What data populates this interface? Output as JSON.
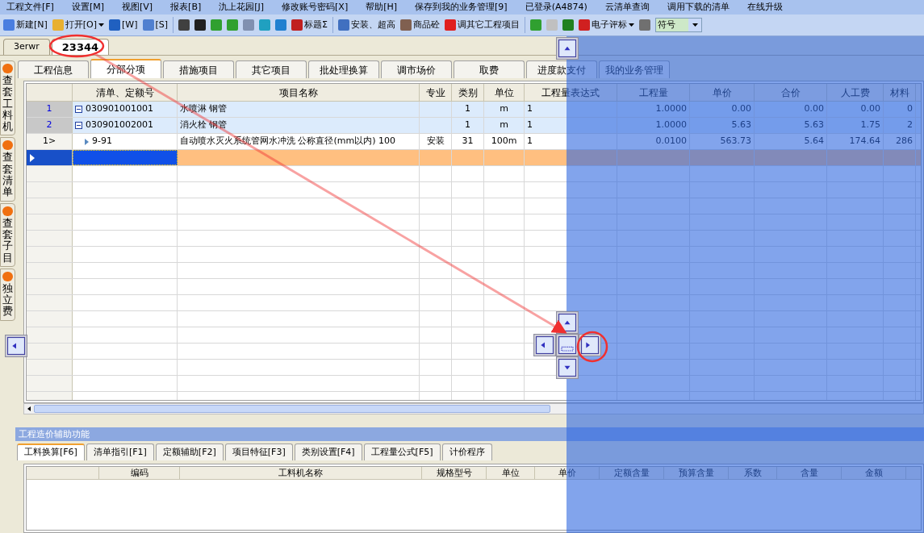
{
  "menu": [
    "工程文件[F]",
    "设置[M]",
    "视图[V]",
    "报表[B]",
    "氿上花园[J]",
    "修改账号密码[X]",
    "帮助[H]",
    "保存到我的业务管理[9]",
    "已登录(A4874)",
    "云清单查询",
    "调用下载的清单",
    "在线升级"
  ],
  "toolbar": [
    {
      "kind": "button",
      "label": "新建[N]"
    },
    {
      "kind": "dropdown",
      "label": "打开[O]"
    },
    {
      "kind": "button",
      "label": "[W]"
    },
    {
      "kind": "button",
      "label": "[S]"
    },
    {
      "kind": "separator"
    },
    {
      "kind": "icon"
    },
    {
      "kind": "icon"
    },
    {
      "kind": "icon"
    },
    {
      "kind": "icon"
    },
    {
      "kind": "icon"
    },
    {
      "kind": "icon"
    },
    {
      "kind": "icon"
    },
    {
      "kind": "button",
      "label": "标题Σ"
    },
    {
      "kind": "separator"
    },
    {
      "kind": "button",
      "label": "安装、超高"
    },
    {
      "kind": "button",
      "label": "商品砼"
    },
    {
      "kind": "button",
      "label": "调其它工程项目"
    },
    {
      "kind": "separator"
    },
    {
      "kind": "icon"
    },
    {
      "kind": "icon",
      "disabled": true
    },
    {
      "kind": "icon"
    },
    {
      "kind": "dropdown",
      "label": "电子评标"
    },
    {
      "kind": "icon"
    },
    {
      "kind": "combo",
      "value": "符号"
    }
  ],
  "doc_tabs": [
    {
      "label": "3erwr",
      "selected": false
    },
    {
      "label": "23344",
      "selected": true
    }
  ],
  "side_tabs": [
    "查套工料机",
    "查套清单",
    "查套子目",
    "独立费"
  ],
  "tabs": [
    {
      "label": "工程信息",
      "selected": false
    },
    {
      "label": "分部分项",
      "selected": true
    },
    {
      "label": "措施项目",
      "selected": false
    },
    {
      "label": "其它项目",
      "selected": false
    },
    {
      "label": "批处理换算",
      "selected": false
    },
    {
      "label": "调市场价",
      "selected": false
    },
    {
      "label": "取费",
      "selected": false
    },
    {
      "label": "进度款支付",
      "selected": false
    },
    {
      "label": "我的业务管理",
      "selected": false
    }
  ],
  "table": {
    "columns": [
      "清单、定额号",
      "项目名称",
      "专业",
      "类别",
      "单位",
      "工程量表达式",
      "工程量",
      "单价",
      "合价",
      "人工费",
      "材料"
    ],
    "rows": [
      {
        "kind": "bill",
        "number": "1",
        "expanded": true,
        "selected": false,
        "cells": [
          "030901001001",
          "水喷淋 钢管",
          null,
          "1",
          "m",
          "1",
          "1.0000",
          "0.00",
          "0.00",
          "0.00",
          "0"
        ]
      },
      {
        "kind": "bill",
        "number": "2",
        "expanded": true,
        "selected": false,
        "cells": [
          "030901002001",
          "消火栓 钢管",
          null,
          "1",
          "m",
          "1",
          "1.0000",
          "5.63",
          "5.63",
          "1.75",
          "2"
        ]
      },
      {
        "kind": "quota",
        "number": "1>",
        "selected": false,
        "cells": [
          "9-91",
          "自动喷水灭火系统管网水冲洗 公称直径(mm以内) 100",
          "安装",
          "31",
          "100m",
          "1",
          "0.0100",
          "563.73",
          "5.64",
          "174.64",
          "286"
        ]
      },
      {
        "kind": "new",
        "selected": true
      }
    ]
  },
  "assist": {
    "title": "工程造价辅助功能",
    "tabs": [
      {
        "label": "工料换算[F6]",
        "selected": true
      },
      {
        "label": "清单指引[F1]",
        "selected": false
      },
      {
        "label": "定额辅助[F2]",
        "selected": false
      },
      {
        "label": "项目特征[F3]",
        "selected": false
      },
      {
        "label": "类别设置[F4]",
        "selected": false
      },
      {
        "label": "工程量公式[F5]",
        "selected": false
      },
      {
        "label": "计价程序",
        "selected": false
      }
    ],
    "columns": [
      "编码",
      "工料机名称",
      "规格型号",
      "单位",
      "单价",
      "定额含量",
      "预算含量",
      "系数",
      "含量",
      "金额"
    ]
  }
}
